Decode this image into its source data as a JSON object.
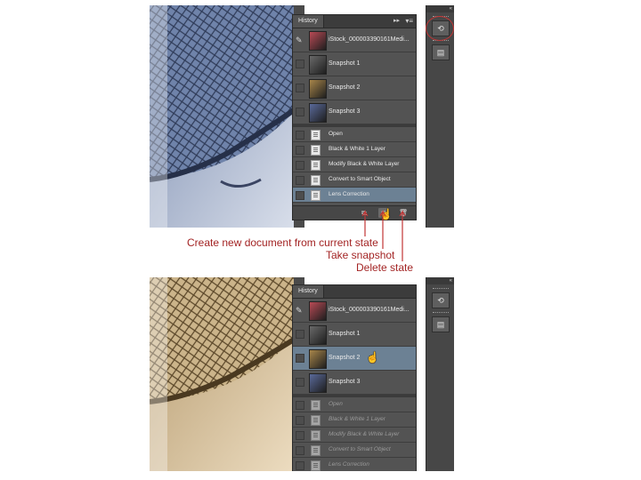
{
  "colors": {
    "callout_text": "#a32424",
    "callout_line": "#c23535",
    "panel_bg": "#535353",
    "selected_row": "#6c8194"
  },
  "panel": {
    "tab_label": "History",
    "collapse_glyph": "▸▸",
    "menu_glyph": "▾≡"
  },
  "top": {
    "rows": [
      {
        "label": "iStock_000003390161Medi...",
        "thumb_color": "#b84a55"
      },
      {
        "label": "Snapshot 1",
        "thumb_color": "#6a6a6a"
      },
      {
        "label": "Snapshot 2",
        "thumb_color": "#a8864a"
      },
      {
        "label": "Snapshot 3",
        "thumb_color": "#5a6a9a"
      }
    ],
    "states": [
      {
        "label": "Open"
      },
      {
        "label": "Black & White 1 Layer"
      },
      {
        "label": "Modify Black & White Layer"
      },
      {
        "label": "Convert to Smart Object"
      },
      {
        "label": "Lens Correction"
      }
    ]
  },
  "bottom": {
    "rows": [
      {
        "label": "iStock_000003390161Medi...",
        "thumb_color": "#b84a55"
      },
      {
        "label": "Snapshot 1",
        "thumb_color": "#6a6a6a"
      },
      {
        "label": "Snapshot 2",
        "thumb_color": "#a8864a"
      },
      {
        "label": "Snapshot 3",
        "thumb_color": "#5a6a9a"
      }
    ],
    "states": [
      {
        "label": "Open"
      },
      {
        "label": "Black & White 1 Layer"
      },
      {
        "label": "Modify Black & White Layer"
      },
      {
        "label": "Convert to Smart Object"
      },
      {
        "label": "Lens Correction"
      }
    ]
  },
  "footer": {
    "new_doc_glyph": "⧉",
    "snapshot_glyph": "◙",
    "delete_glyph": "🗑"
  },
  "tools": {
    "collapse_glyph": "«",
    "history_glyph": "⟲",
    "swatch_glyph": "▤"
  },
  "callouts": {
    "new_doc": "Create new document from current state",
    "snapshot": "Take snapshot",
    "delete": "Delete state"
  }
}
